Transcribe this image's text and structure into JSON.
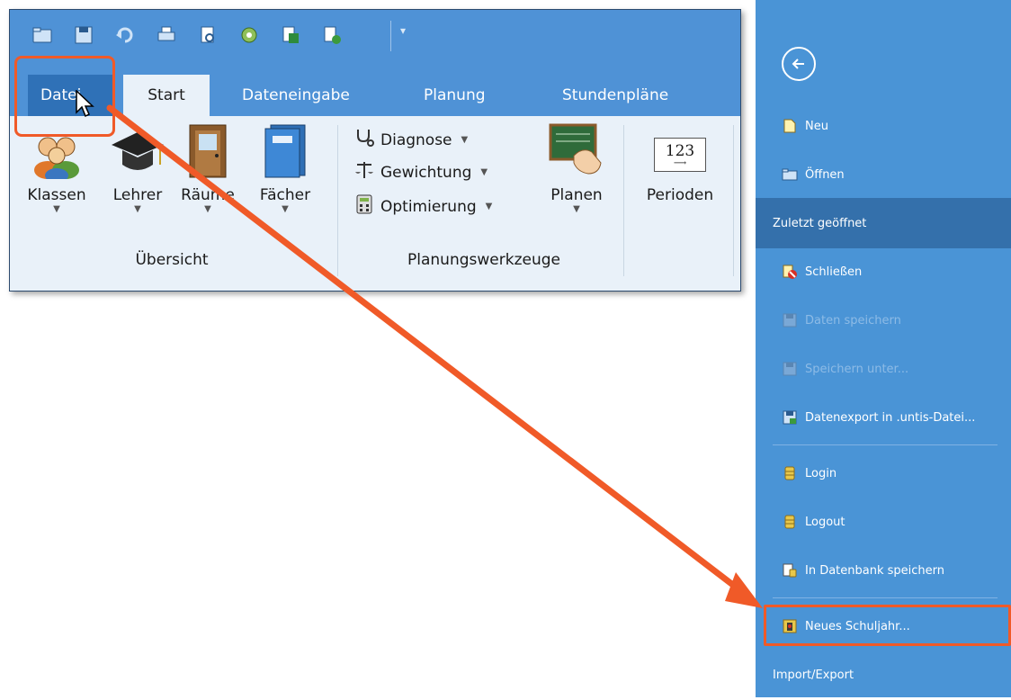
{
  "ribbon": {
    "tabs": [
      {
        "label": "Datei"
      },
      {
        "label": "Start"
      },
      {
        "label": "Dateneingabe"
      },
      {
        "label": "Planung"
      },
      {
        "label": "Stundenpläne"
      }
    ],
    "overview_buttons": [
      {
        "label": "Klassen",
        "icon": "users-icon"
      },
      {
        "label": "Lehrer",
        "icon": "graduation-cap-icon"
      },
      {
        "label": "Räume",
        "icon": "door-icon"
      },
      {
        "label": "Fächer",
        "icon": "book-icon"
      }
    ],
    "overview_group_label": "Übersicht",
    "planning_tools": [
      {
        "label": "Diagnose",
        "icon": "stethoscope-icon"
      },
      {
        "label": "Gewichtung",
        "icon": "scales-icon"
      },
      {
        "label": "Optimierung",
        "icon": "calculator-icon"
      }
    ],
    "planen_label": "Planen",
    "planning_group_label": "Planungswerkzeuge",
    "perioden_label": "Perioden",
    "perioden_icon_text": "123"
  },
  "backstage": {
    "items": [
      {
        "label": "Neu",
        "icon": "new-file-icon",
        "state": "normal"
      },
      {
        "label": "Öffnen",
        "icon": "folder-icon",
        "state": "normal"
      },
      {
        "label": "Zuletzt geöffnet",
        "icon": "",
        "state": "active"
      },
      {
        "label": "Schließen",
        "icon": "close-file-icon",
        "state": "normal"
      },
      {
        "label": "Daten speichern",
        "icon": "save-icon",
        "state": "disabled"
      },
      {
        "label": "Speichern unter...",
        "icon": "save-as-icon",
        "state": "disabled"
      },
      {
        "label": "Datenexport in .untis-Datei...",
        "icon": "export-icon",
        "state": "normal"
      },
      {
        "label": "Login",
        "icon": "database-icon",
        "state": "normal"
      },
      {
        "label": "Logout",
        "icon": "database-icon",
        "state": "normal"
      },
      {
        "label": "In Datenbank speichern",
        "icon": "db-save-icon",
        "state": "normal"
      },
      {
        "label": "Neues Schuljahr...",
        "icon": "new-year-icon",
        "state": "highlighted"
      },
      {
        "label": "Import/Export",
        "icon": "",
        "state": "normal"
      }
    ]
  },
  "colors": {
    "ribbon_blue": "#4f92d6",
    "backstage_blue": "#4a94d6",
    "active_item": "#3470ab",
    "highlight_orange": "#f05a28"
  }
}
